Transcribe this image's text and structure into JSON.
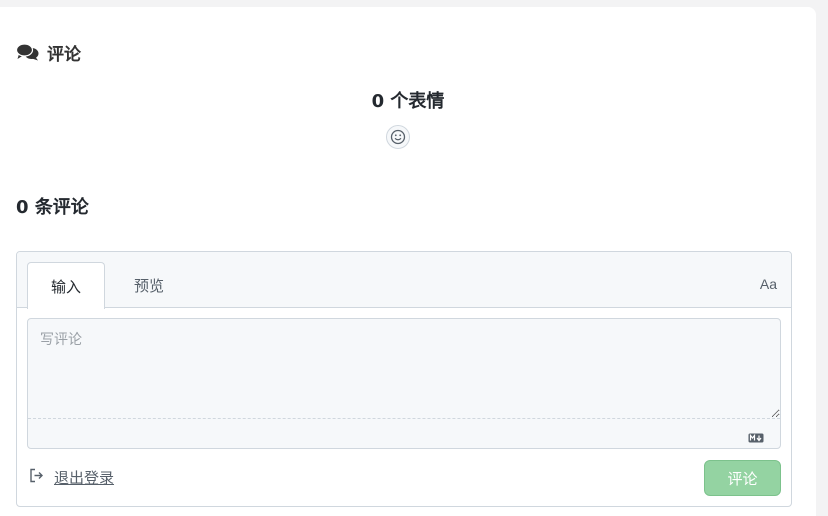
{
  "header": {
    "title": "评论",
    "icon": "comments-icon"
  },
  "reactions": {
    "count": "0",
    "label": "个表情",
    "add_icon": "smiley-icon"
  },
  "comments": {
    "count": "0",
    "label": "条评论"
  },
  "editor": {
    "tabs": [
      {
        "label": "输入",
        "active": true
      },
      {
        "label": "预览",
        "active": false
      }
    ],
    "format_toggle": "Aa",
    "placeholder": "写评论",
    "value": "",
    "markdown_icon": "markdown-icon"
  },
  "footer": {
    "logout_label": "退出登录",
    "logout_icon": "sign-out-icon",
    "submit_label": "评论",
    "submit_color": "#94d3a2"
  }
}
